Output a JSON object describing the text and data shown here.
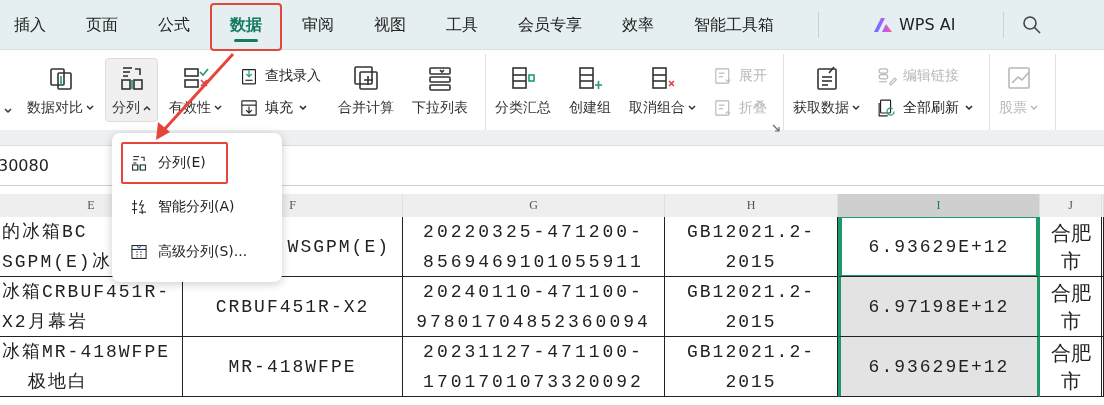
{
  "tabs": [
    {
      "label": "插入",
      "selected": false,
      "highlighted": false
    },
    {
      "label": "页面",
      "selected": false,
      "highlighted": false
    },
    {
      "label": "公式",
      "selected": false,
      "highlighted": false
    },
    {
      "label": "数据",
      "selected": true,
      "highlighted": true
    },
    {
      "label": "审阅",
      "selected": false,
      "highlighted": false
    },
    {
      "label": "视图",
      "selected": false,
      "highlighted": false
    },
    {
      "label": "工具",
      "selected": false,
      "highlighted": false
    },
    {
      "label": "会员专享",
      "selected": false,
      "highlighted": false
    },
    {
      "label": "效率",
      "selected": false,
      "highlighted": false
    },
    {
      "label": "智能工具箱",
      "selected": false,
      "highlighted": false
    }
  ],
  "ai_button": {
    "label": "WPS AI"
  },
  "ribbon": {
    "groups": [
      {
        "items": [
          {
            "kind": "stub",
            "expanded": false
          },
          {
            "kind": "large",
            "label": "数据对比",
            "expanded": false,
            "disabled": false
          },
          {
            "kind": "large",
            "label": "分列",
            "expanded": true,
            "disabled": false
          },
          {
            "kind": "large",
            "label": "有效性",
            "expanded": false,
            "disabled": false
          },
          {
            "kind": "stack",
            "items": [
              {
                "label": "查找录入",
                "disabled": false
              },
              {
                "label": "填充",
                "expanded": false,
                "disabled": false
              }
            ]
          },
          {
            "kind": "large",
            "label": "合并计算",
            "disabled": false
          },
          {
            "kind": "large",
            "label": "下拉列表",
            "disabled": false
          }
        ]
      },
      {
        "launcher": true,
        "items": [
          {
            "kind": "large",
            "label": "分类汇总",
            "disabled": false
          },
          {
            "kind": "large",
            "label": "创建组",
            "disabled": false
          },
          {
            "kind": "large",
            "label": "取消组合",
            "expanded": false,
            "disabled": false
          },
          {
            "kind": "stack",
            "items": [
              {
                "label": "展开",
                "disabled": true
              },
              {
                "label": "折叠",
                "disabled": true
              }
            ]
          }
        ]
      },
      {
        "items": [
          {
            "kind": "large",
            "label": "获取数据",
            "expanded": false,
            "disabled": false
          },
          {
            "kind": "stack",
            "items": [
              {
                "label": "编辑链接",
                "disabled": true
              },
              {
                "label": "全部刷新",
                "expanded": false,
                "disabled": false
              }
            ]
          }
        ]
      },
      {
        "items": [
          {
            "kind": "large",
            "label": "股票",
            "expanded": false,
            "disabled": true
          }
        ]
      }
    ]
  },
  "formula_bar": {
    "value": "30080"
  },
  "sheet": {
    "columns": [
      {
        "label": "E",
        "selected": false
      },
      {
        "label": "F",
        "selected": false
      },
      {
        "label": "G",
        "selected": false
      },
      {
        "label": "H",
        "selected": false
      },
      {
        "label": "I",
        "selected": true
      },
      {
        "label": "J",
        "selected": false
      }
    ],
    "rows": [
      {
        "cells": [
          {
            "text": "的冰箱BC\nSGPM(E)冰",
            "selected": false,
            "active": false
          },
          {
            "text": "WSGPM(E)",
            "selected": false,
            "active": false
          },
          {
            "text": "20220325-471200-\n8569469101055911",
            "selected": false,
            "active": false
          },
          {
            "text": "GB12021.2-\n2015",
            "selected": false,
            "active": false
          },
          {
            "text": "6.93629E+12",
            "selected": true,
            "active": true
          },
          {
            "text": "合肥市",
            "selected": false,
            "active": false
          }
        ]
      },
      {
        "cells": [
          {
            "text": "冰箱CRBUF451R-\nX2月幕岩",
            "selected": false,
            "active": false
          },
          {
            "text": "CRBUF451R-X2",
            "selected": false,
            "active": false
          },
          {
            "text": "20240110-471100-\n97801704852360094",
            "selected": false,
            "active": false
          },
          {
            "text": "GB12021.2-\n2015",
            "selected": false,
            "active": false
          },
          {
            "text": "6.97198E+12",
            "selected": true,
            "active": false
          },
          {
            "text": "合肥市",
            "selected": false,
            "active": false
          }
        ]
      },
      {
        "cells": [
          {
            "text": "冰箱MR-418WFPE\n  极地白",
            "selected": false,
            "active": false
          },
          {
            "text": "MR-418WFPE",
            "selected": false,
            "active": false
          },
          {
            "text": "20231127-471100-\n1701701073320092",
            "selected": false,
            "active": false
          },
          {
            "text": "GB12021.2-\n2015",
            "selected": false,
            "active": false
          },
          {
            "text": "6.93629E+12",
            "selected": true,
            "active": false
          },
          {
            "text": "合肥市",
            "selected": false,
            "active": false
          }
        ]
      }
    ]
  },
  "menu": {
    "items": [
      {
        "label": "分列(E)",
        "highlighted": true
      },
      {
        "label": "智能分列(A)",
        "highlighted": false
      },
      {
        "label": "高级分列(S)...",
        "highlighted": false
      }
    ]
  }
}
